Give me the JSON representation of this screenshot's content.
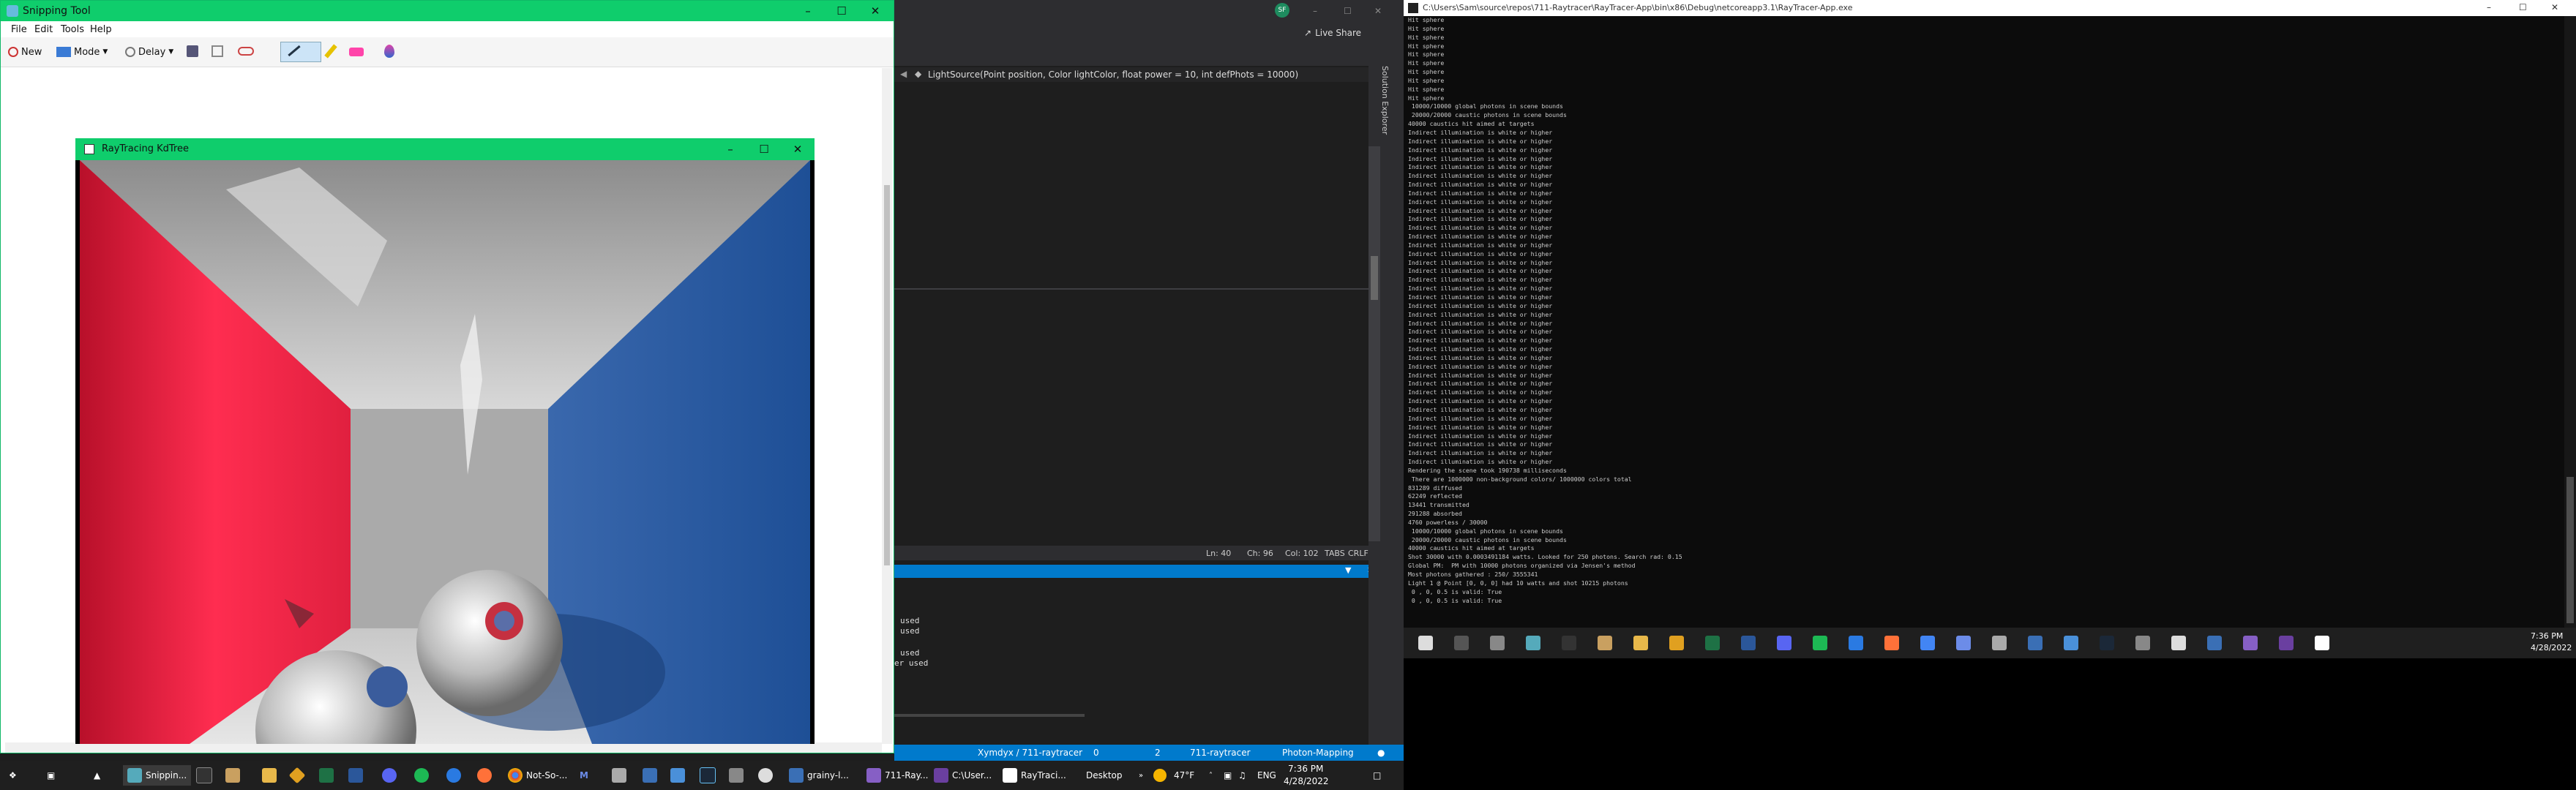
{
  "colors": {
    "accent_green": "#0fcd6c",
    "vs_blue": "#007acc",
    "red_wall": "#dd2040",
    "blue_wall": "#2f5c9e"
  },
  "snipping_tool": {
    "title": "Snipping Tool",
    "menu": [
      "File",
      "Edit",
      "Tools",
      "Help"
    ],
    "toolbar": {
      "new_label": "New",
      "mode_label": "Mode",
      "delay_label": "Delay"
    }
  },
  "raytracer_window": {
    "title": "RayTracing KdTree"
  },
  "visual_studio": {
    "user_initials": "SF",
    "live_share": "Live Share",
    "solution_explorer": "Solution Explorer",
    "signature": "LightSource(Point position, Color lightColor, float power = 10, int defPhots = 10000)",
    "status_line": {
      "ln": "Ln: 40",
      "ch": "Ch: 96",
      "col": "Col: 102",
      "tabs": "TABS",
      "eol": "CRLF"
    },
    "output_lines": [
      "used",
      "used",
      "used",
      "er used"
    ],
    "statusbar": {
      "repo": "Xymdyx / 711-raytracer",
      "up": "0",
      "edits": "2",
      "branch_repo": "711-raytracer",
      "branch": "Photon-Mapping"
    }
  },
  "console": {
    "title": "C:\\Users\\Sam\\source\\repos\\711-Raytracer\\RayTracer-App\\bin\\x86\\Debug\\netcoreapp3.1\\RayTracer-App.exe",
    "lines": [
      "Hit sphere",
      "Hit sphere",
      "Hit sphere",
      "Hit sphere",
      "Hit sphere",
      "Hit sphere",
      "Hit sphere",
      "Hit sphere",
      "Hit sphere",
      "Hit sphere",
      " 10000/10000 global photons in scene bounds",
      " 20000/20000 caustic photons in scene bounds",
      "40000 caustics hit aimed at targets",
      "Indirect illumination is white or higher",
      "Indirect illumination is white or higher",
      "Indirect illumination is white or higher",
      "Indirect illumination is white or higher",
      "Indirect illumination is white or higher",
      "Indirect illumination is white or higher",
      "Indirect illumination is white or higher",
      "Indirect illumination is white or higher",
      "Indirect illumination is white or higher",
      "Indirect illumination is white or higher",
      "Indirect illumination is white or higher",
      "Indirect illumination is white or higher",
      "Indirect illumination is white or higher",
      "Indirect illumination is white or higher",
      "Indirect illumination is white or higher",
      "Indirect illumination is white or higher",
      "Indirect illumination is white or higher",
      "Indirect illumination is white or higher",
      "Indirect illumination is white or higher",
      "Indirect illumination is white or higher",
      "Indirect illumination is white or higher",
      "Indirect illumination is white or higher",
      "Indirect illumination is white or higher",
      "Indirect illumination is white or higher",
      "Indirect illumination is white or higher",
      "Indirect illumination is white or higher",
      "Indirect illumination is white or higher",
      "Indirect illumination is white or higher",
      "Indirect illumination is white or higher",
      "Indirect illumination is white or higher",
      "Indirect illumination is white or higher",
      "Indirect illumination is white or higher",
      "Indirect illumination is white or higher",
      "Indirect illumination is white or higher",
      "Indirect illumination is white or higher",
      "Indirect illumination is white or higher",
      "Indirect illumination is white or higher",
      "Indirect illumination is white or higher",
      "Indirect illumination is white or higher",
      "Rendering the scene took 190738 milliseconds",
      " There are 1000000 non-background colors/ 1000000 colors total",
      "831289 diffused",
      "62249 reflected",
      "13441 transmitted",
      "291288 absorbed",
      "4760 powerless / 30000",
      " 10000/10000 global photons in scene bounds",
      " 20000/20000 caustic photons in scene bounds",
      "40000 caustics hit aimed at targets",
      "Shot 30000 with 0.0003491184 watts. Looked for 250 photons. Search rad: 0.15",
      "Global PM:  PM with 10000 photons organized via Jensen's method",
      "Most photons gathered : 250/ 3555341",
      "Light 1 @ Point [0, 0, 0] had 10 watts and shot 10215 photons",
      " 0 , 0, 0.5 is valid: True",
      " 0 , 0, 0.5 is valid: True"
    ]
  },
  "taskbar_secondary": {
    "time": "7:36 PM",
    "date": "4/28/2022"
  },
  "taskbar_main": {
    "items": [
      {
        "label": "Snippin..."
      },
      {
        "label": "Not-So-..."
      },
      {
        "label": "grainy-l..."
      },
      {
        "label": "711-Ray..."
      },
      {
        "label": "C:\\User..."
      },
      {
        "label": "RayTraci..."
      }
    ],
    "desktop_label": "Desktop",
    "weather": "47°F",
    "language": "ENG",
    "time": "7:36 PM",
    "date": "4/28/2022"
  }
}
